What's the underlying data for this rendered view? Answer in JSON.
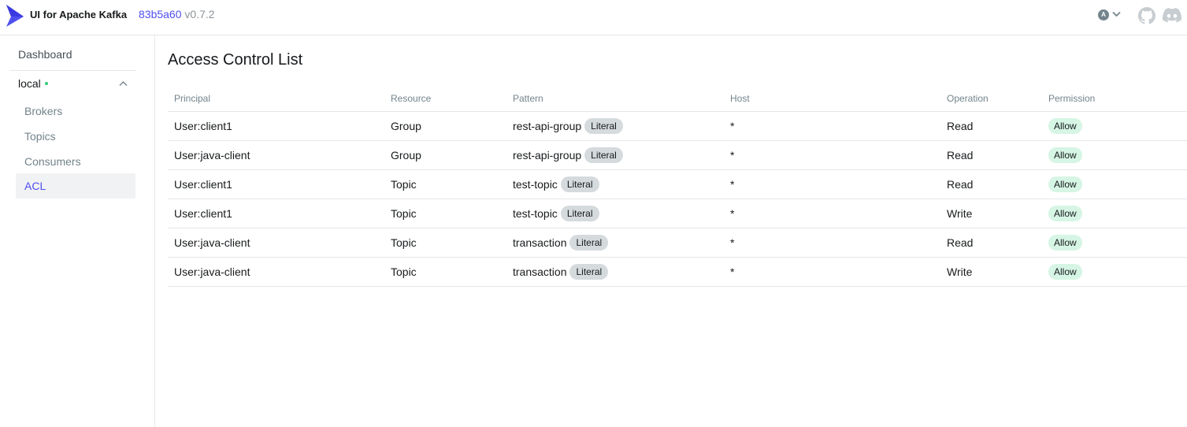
{
  "header": {
    "app_title": "UI for Apache Kafka",
    "commit_hash": "83b5a60",
    "version": "v0.7.2",
    "avatar_initial": "A",
    "accent_color": "#4f4ff0"
  },
  "sidebar": {
    "dashboard_label": "Dashboard",
    "cluster_name": "local",
    "cluster_status_color": "#30c978",
    "items": [
      {
        "label": "Brokers"
      },
      {
        "label": "Topics"
      },
      {
        "label": "Consumers"
      },
      {
        "label": "ACL"
      }
    ],
    "active_item": "ACL"
  },
  "main": {
    "title": "Access Control List",
    "columns": [
      "Principal",
      "Resource",
      "Pattern",
      "Host",
      "Operation",
      "Permission"
    ],
    "rows": [
      {
        "principal": "User:client1",
        "resource": "Group",
        "pattern": "rest-api-group",
        "pattern_type": "Literal",
        "host": "*",
        "operation": "Read",
        "permission": "Allow"
      },
      {
        "principal": "User:java-client",
        "resource": "Group",
        "pattern": "rest-api-group",
        "pattern_type": "Literal",
        "host": "*",
        "operation": "Read",
        "permission": "Allow"
      },
      {
        "principal": "User:client1",
        "resource": "Topic",
        "pattern": "test-topic",
        "pattern_type": "Literal",
        "host": "*",
        "operation": "Read",
        "permission": "Allow"
      },
      {
        "principal": "User:client1",
        "resource": "Topic",
        "pattern": "test-topic",
        "pattern_type": "Literal",
        "host": "*",
        "operation": "Write",
        "permission": "Allow"
      },
      {
        "principal": "User:java-client",
        "resource": "Topic",
        "pattern": "transaction",
        "pattern_type": "Literal",
        "host": "*",
        "operation": "Read",
        "permission": "Allow"
      },
      {
        "principal": "User:java-client",
        "resource": "Topic",
        "pattern": "transaction",
        "pattern_type": "Literal",
        "host": "*",
        "operation": "Write",
        "permission": "Allow"
      }
    ]
  }
}
